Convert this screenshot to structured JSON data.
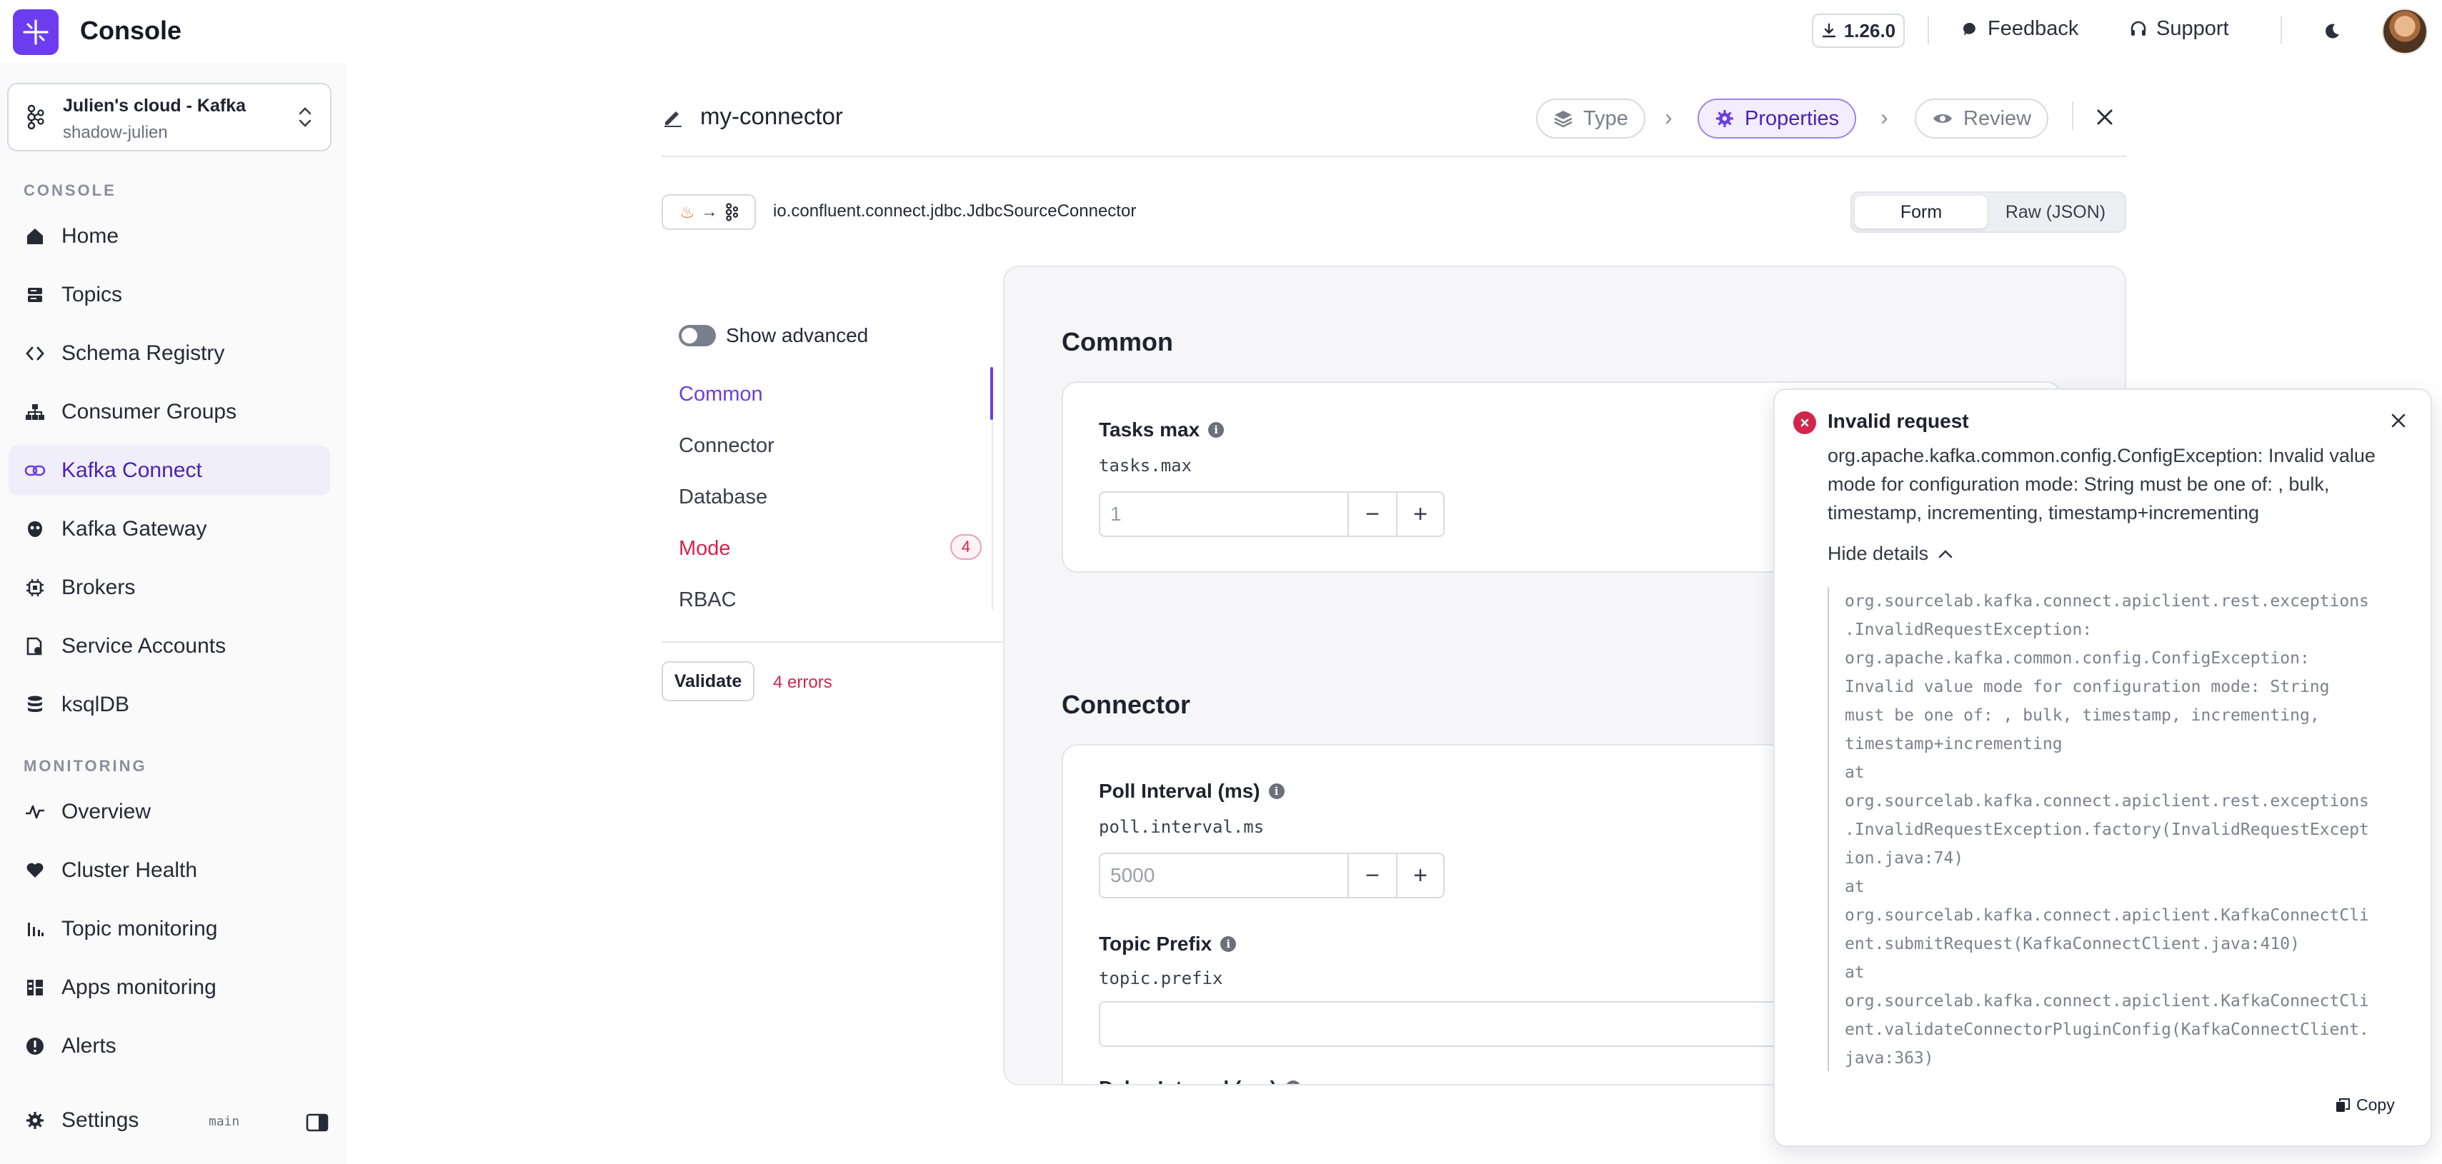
{
  "app": {
    "title": "Console"
  },
  "topbar": {
    "version": "1.26.0",
    "feedback": "Feedback",
    "support": "Support"
  },
  "cluster": {
    "name": "Julien's cloud - Kafka",
    "sub": "shadow-julien"
  },
  "sidebar": {
    "console_label": "CONSOLE",
    "monitoring_label": "MONITORING",
    "items": [
      {
        "label": "Home",
        "icon": "home-icon"
      },
      {
        "label": "Topics",
        "icon": "topics-icon"
      },
      {
        "label": "Schema Registry",
        "icon": "code-icon"
      },
      {
        "label": "Consumer Groups",
        "icon": "hierarchy-icon"
      },
      {
        "label": "Kafka Connect",
        "icon": "link-icon"
      },
      {
        "label": "Kafka Gateway",
        "icon": "gateway-icon"
      },
      {
        "label": "Brokers",
        "icon": "chip-icon"
      },
      {
        "label": "Service Accounts",
        "icon": "id-card-icon"
      },
      {
        "label": "ksqlDB",
        "icon": "database-icon"
      }
    ],
    "monitoring": [
      {
        "label": "Overview",
        "icon": "pulse-icon"
      },
      {
        "label": "Cluster Health",
        "icon": "heart-icon"
      },
      {
        "label": "Topic monitoring",
        "icon": "bar-chart-icon"
      },
      {
        "label": "Apps monitoring",
        "icon": "apps-icon"
      },
      {
        "label": "Alerts",
        "icon": "alert-icon"
      }
    ],
    "settings": "Settings",
    "branch": "main"
  },
  "connector": {
    "name": "my-connector",
    "steps": {
      "type": "Type",
      "properties": "Properties",
      "review": "Review"
    },
    "plugin_class": "io.confluent.connect.jdbc.JdbcSourceConnector",
    "view_form": "Form",
    "view_raw": "Raw (JSON)"
  },
  "form_nav": {
    "show_advanced": "Show advanced",
    "items": [
      "Common",
      "Connector",
      "Database",
      "Mode",
      "RBAC"
    ],
    "mode_errors": "4",
    "validate": "Validate",
    "errors": "4 errors"
  },
  "form": {
    "common_title": "Common",
    "tasks_max_label": "Tasks max",
    "tasks_max_key": "tasks.max",
    "tasks_max_placeholder": "1",
    "connector_title": "Connector",
    "poll_label": "Poll Interval (ms)",
    "poll_key": "poll.interval.ms",
    "poll_placeholder": "5000",
    "topic_prefix_label": "Topic Prefix",
    "topic_prefix_key": "topic.prefix",
    "delay_label": "Delay Interval (ms)"
  },
  "toast": {
    "title": "Invalid request",
    "message": "org.apache.kafka.common.config.ConfigException: Invalid value mode for configuration mode: String must be one of: , bulk, timestamp, incrementing, timestamp+incrementing",
    "hide_details": "Hide details",
    "details": "org.sourcelab.kafka.connect.apiclient.rest.exceptions\n.InvalidRequestException:\norg.apache.kafka.common.config.ConfigException:\nInvalid value mode for configuration mode: String\nmust be one of: , bulk, timestamp, incrementing,\ntimestamp+incrementing\nat\norg.sourcelab.kafka.connect.apiclient.rest.exceptions\n.InvalidRequestException.factory(InvalidRequestExcept\nion.java:74)\nat\norg.sourcelab.kafka.connect.apiclient.KafkaConnectCli\nent.submitRequest(KafkaConnectClient.java:410)\nat\norg.sourcelab.kafka.connect.apiclient.KafkaConnectCli\nent.validateConnectorPluginConfig(KafkaConnectClient.\njava:363)",
    "copy": "Copy"
  },
  "colors": {
    "accent": "#6b3fe3",
    "error": "#d2254b"
  }
}
